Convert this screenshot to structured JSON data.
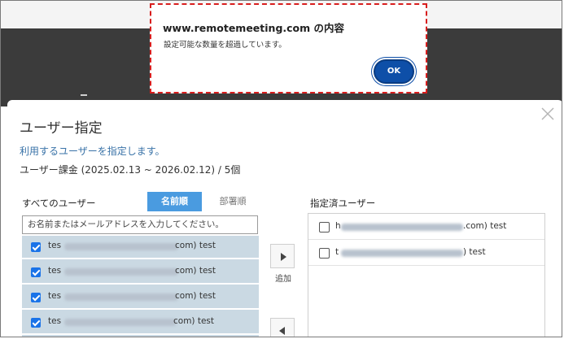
{
  "alert": {
    "title": "www.remotemeeting.com の内容",
    "message": "設定可能な数量を超過しています。",
    "ok_label": "OK"
  },
  "modal": {
    "title": "ユーザー指定",
    "subtitle": "利用するユーザーを指定します。",
    "billing": "ユーザー課金 (2025.02.13 ~ 2026.02.12) / 5個"
  },
  "left_panel": {
    "title": "すべてのユーザー",
    "sort_name": "名前順",
    "sort_dept": "部署順",
    "search_placeholder": "お名前またはメールアドレスを入力してください。",
    "rows": [
      {
        "prefix": "tes",
        "suffix": "com) test",
        "checked": true
      },
      {
        "prefix": "tes",
        "suffix": "com) test",
        "checked": true
      },
      {
        "prefix": "tes",
        "suffix": "com) test",
        "checked": true
      },
      {
        "prefix": "tes",
        "suffix": "com) test",
        "checked": true
      }
    ]
  },
  "transfer": {
    "add_label": "追加"
  },
  "right_panel": {
    "title": "指定済ユーザー",
    "rows": [
      {
        "prefix": "h",
        "suffix": ".com) test",
        "checked": false
      },
      {
        "prefix": "t",
        "suffix": ") test",
        "checked": false
      }
    ]
  },
  "colors": {
    "accent": "#4a9be0",
    "ok_button": "#0e4fa8",
    "alert_border": "#d81e1e",
    "subtitle": "#3a73a8",
    "list_selected": "#cad9e3"
  },
  "icons": {
    "close": "close-icon",
    "add": "arrow-right-icon",
    "remove": "arrow-left-icon",
    "checkbox": "checkbox-icon"
  }
}
